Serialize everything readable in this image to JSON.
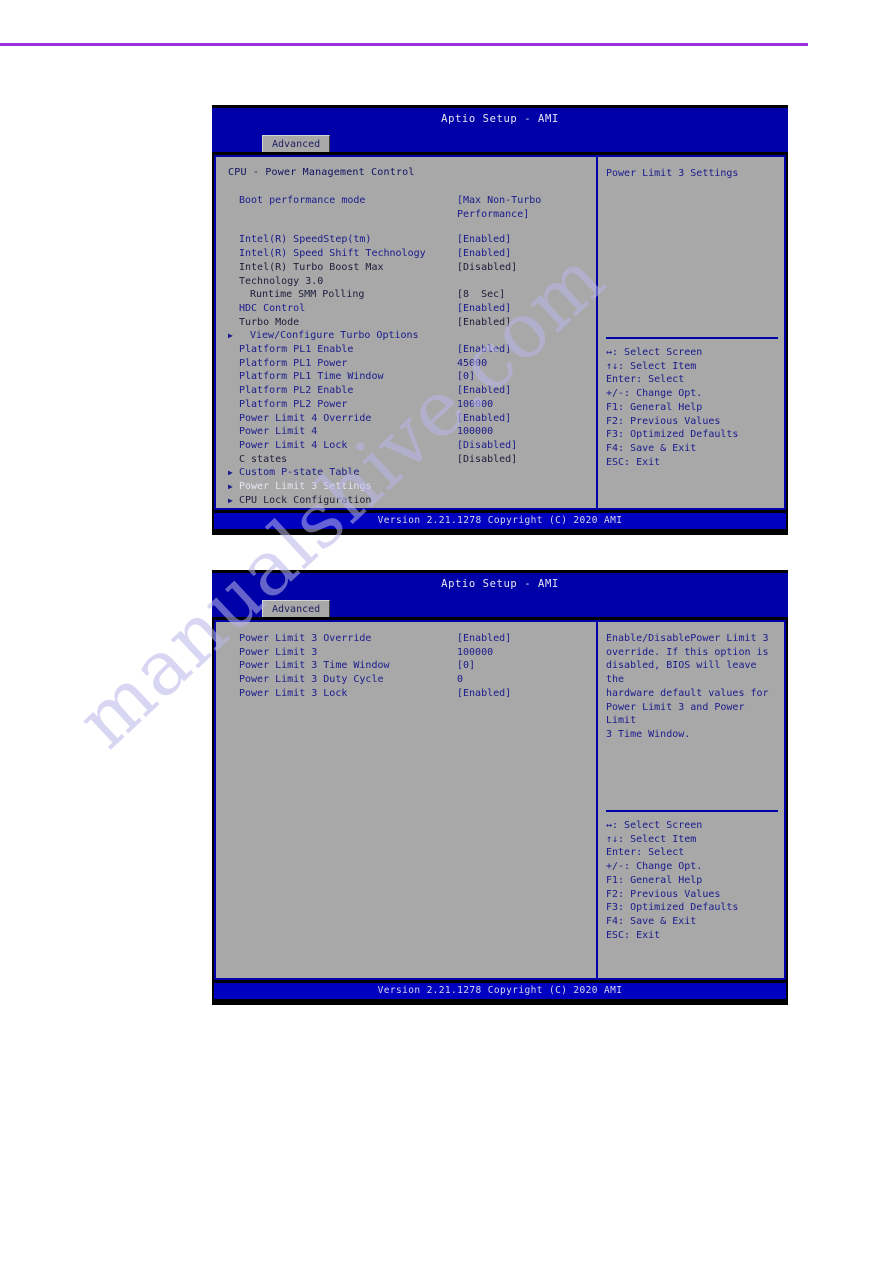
{
  "page": {
    "watermark": "manualshive.com",
    "rule_color": "#9b30e0"
  },
  "screens": [
    {
      "title": "Aptio Setup - AMI",
      "tab": "Advanced",
      "section_title": "CPU - Power Management Control",
      "items": [
        {
          "bullet": "",
          "label": "Boot performance mode",
          "value": "[Max Non-Turbo",
          "gap": true
        },
        {
          "bullet": "",
          "label": "",
          "value": "Performance]",
          "cont": true
        },
        {
          "bullet": "",
          "label": "Intel(R) SpeedStep(tm)",
          "value": "[Enabled]",
          "gap": true
        },
        {
          "bullet": "",
          "label": "Intel(R) Speed Shift Technology",
          "value": "[Enabled]"
        },
        {
          "bullet": "",
          "label": "Intel(R) Turbo Boost Max",
          "value": "[Disabled]",
          "dark": true
        },
        {
          "bullet": "",
          "label": "Technology 3.0",
          "value": "",
          "dark": true
        },
        {
          "bullet": "",
          "label": "Runtime SMM Polling",
          "value": "[8  Sec]",
          "indent": true,
          "dark": true
        },
        {
          "bullet": "",
          "label": "HDC Control",
          "value": "[Enabled]"
        },
        {
          "bullet": "",
          "label": "Turbo Mode",
          "value": "[Enabled]",
          "dark": true
        },
        {
          "bullet": "▶",
          "label": "View/Configure Turbo Options",
          "value": "",
          "indent": true
        },
        {
          "bullet": "",
          "label": "Platform PL1 Enable",
          "value": "[Enabled]"
        },
        {
          "bullet": "",
          "label": "Platform PL1 Power",
          "value": "45000"
        },
        {
          "bullet": "",
          "label": "Platform PL1 Time Window",
          "value": "[0]"
        },
        {
          "bullet": "",
          "label": "Platform PL2 Enable",
          "value": "[Enabled]"
        },
        {
          "bullet": "",
          "label": "Platform PL2 Power",
          "value": "100000"
        },
        {
          "bullet": "",
          "label": "Power Limit 4 Override",
          "value": "[Enabled]"
        },
        {
          "bullet": "",
          "label": "Power Limit 4",
          "value": "100000"
        },
        {
          "bullet": "",
          "label": "Power Limit 4 Lock",
          "value": "[Disabled]"
        },
        {
          "bullet": "",
          "label": "C states",
          "value": "[Disabled]",
          "dark": true
        },
        {
          "bullet": "▶",
          "label": "Custom P-state Table",
          "value": ""
        },
        {
          "bullet": "▶",
          "label": "Power Limit 3 Settings",
          "value": "",
          "selected": true
        },
        {
          "bullet": "▶",
          "label": "CPU Lock Configuration",
          "value": "",
          "dark": true
        }
      ],
      "help": "Power Limit 3 Settings",
      "hotkeys": [
        "↔: Select Screen",
        "↑↓: Select Item",
        "Enter: Select",
        "+/-: Change Opt.",
        "F1: General Help",
        "F2: Previous Values",
        "F3: Optimized Defaults",
        "F4: Save & Exit",
        "ESC: Exit"
      ],
      "footer": "Version 2.21.1278 Copyright (C) 2020 AMI"
    },
    {
      "title": "Aptio Setup - AMI",
      "tab": "Advanced",
      "section_title": "",
      "items": [
        {
          "bullet": "",
          "label": "Power Limit 3 Override",
          "value": "[Enabled]"
        },
        {
          "bullet": "",
          "label": "Power Limit 3",
          "value": "100000"
        },
        {
          "bullet": "",
          "label": "Power Limit 3 Time Window",
          "value": "[0]"
        },
        {
          "bullet": "",
          "label": "Power Limit 3 Duty Cycle",
          "value": "0"
        },
        {
          "bullet": "",
          "label": "Power Limit 3 Lock",
          "value": "[Enabled]"
        }
      ],
      "help": "Enable/DisablePower Limit 3\noverride. If this option is\ndisabled, BIOS will leave the\nhardware default values for\nPower Limit 3 and Power Limit\n3 Time Window.",
      "hotkeys": [
        "↔: Select Screen",
        "↑↓: Select Item",
        "Enter: Select",
        "+/-: Change Opt.",
        "F1: General Help",
        "F2: Previous Values",
        "F3: Optimized Defaults",
        "F4: Save & Exit",
        "ESC: Exit"
      ],
      "footer": "Version 2.21.1278 Copyright (C) 2020 AMI"
    }
  ]
}
